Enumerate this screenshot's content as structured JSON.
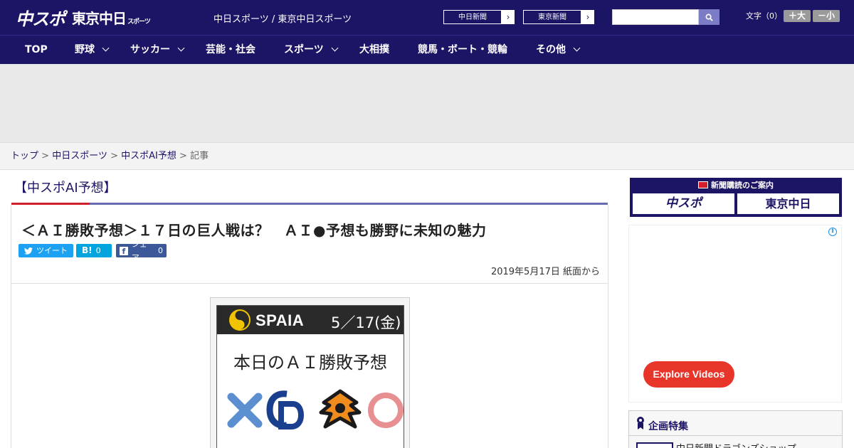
{
  "header": {
    "logo_primary": "中スポ",
    "logo_secondary": "東京中日",
    "logo_secondary_small": "スポーツ",
    "site_names": "中日スポーツ / 東京中日スポーツ",
    "links": [
      {
        "label": "中日新聞"
      },
      {
        "label": "東京新聞"
      }
    ],
    "search_placeholder": "",
    "font_size_label": "文字（0）",
    "font_up": "＋大",
    "font_down": "－小"
  },
  "nav": [
    {
      "label": "TOP"
    },
    {
      "label": "野球"
    },
    {
      "label": "サッカー"
    },
    {
      "label": "芸能・社会"
    },
    {
      "label": "スポーツ"
    },
    {
      "label": "大相撲"
    },
    {
      "label": "競馬・ボート・競輪"
    },
    {
      "label": "その他"
    }
  ],
  "breadcrumb": {
    "items": [
      "トップ",
      "中日スポーツ",
      "中スポAI予想"
    ],
    "current": "記事",
    "separator": ">"
  },
  "section": {
    "title": "【中スポAI予想】"
  },
  "article": {
    "headline": "＜ＡＩ勝敗予想＞１７日の巨人戦は？　ＡＩ●予想も勝野に未知の魅力",
    "share": {
      "tweet": "ツイート",
      "hatena": "B!",
      "hatena_count": "0",
      "facebook": "シェア",
      "facebook_count": "0"
    },
    "date": "2019年5月17日 紙面から",
    "image": {
      "brand": "SPAIA",
      "date": "5／17(金)",
      "title": "本日のＡＩ勝敗予想"
    }
  },
  "sidebar": {
    "subscription_title": "新聞購読のご案内",
    "subscription_logos": [
      "中スポ",
      "東京中日"
    ],
    "ad_button": "Explore Videos",
    "feature_title": "企画特集",
    "feature_item": "中日新聞ドラゴンズショップ"
  },
  "colors": {
    "brand_navy": "#1c1464",
    "accent_red": "#d21e2b",
    "twitter": "#1da1f2",
    "hatena": "#00a4de",
    "facebook": "#3b5998"
  }
}
